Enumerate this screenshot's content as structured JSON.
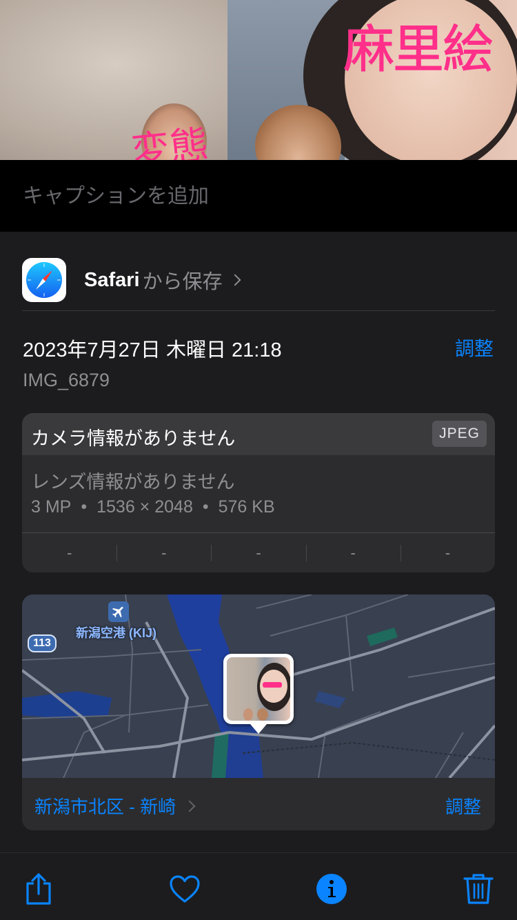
{
  "photo": {
    "overlay_text_large": "麻里絵",
    "overlay_text_small": "変態"
  },
  "caption": {
    "placeholder": "キャプションを追加"
  },
  "source": {
    "app": "Safari",
    "suffix": "から保存"
  },
  "meta": {
    "date": "2023年7月27日 木曜日 21:18",
    "adjust_label": "調整",
    "filename": "IMG_6879"
  },
  "camera_card": {
    "camera": "カメラ情報がありません",
    "format": "JPEG",
    "lens": "レンズ情報がありません",
    "specs": [
      "3 MP",
      "•",
      "1536 × 2048",
      "•",
      "576 KB"
    ],
    "exif": [
      "-",
      "-",
      "-",
      "-",
      "-"
    ]
  },
  "map": {
    "airport_label": "新潟空港 (KIJ)",
    "road_number": "113",
    "place": "新潟市北区 - 新崎",
    "adjust_label": "調整"
  },
  "toolbar": {
    "icons": [
      "share-icon",
      "heart-icon",
      "info-icon",
      "trash-icon"
    ],
    "accent": "#0a84ff"
  }
}
